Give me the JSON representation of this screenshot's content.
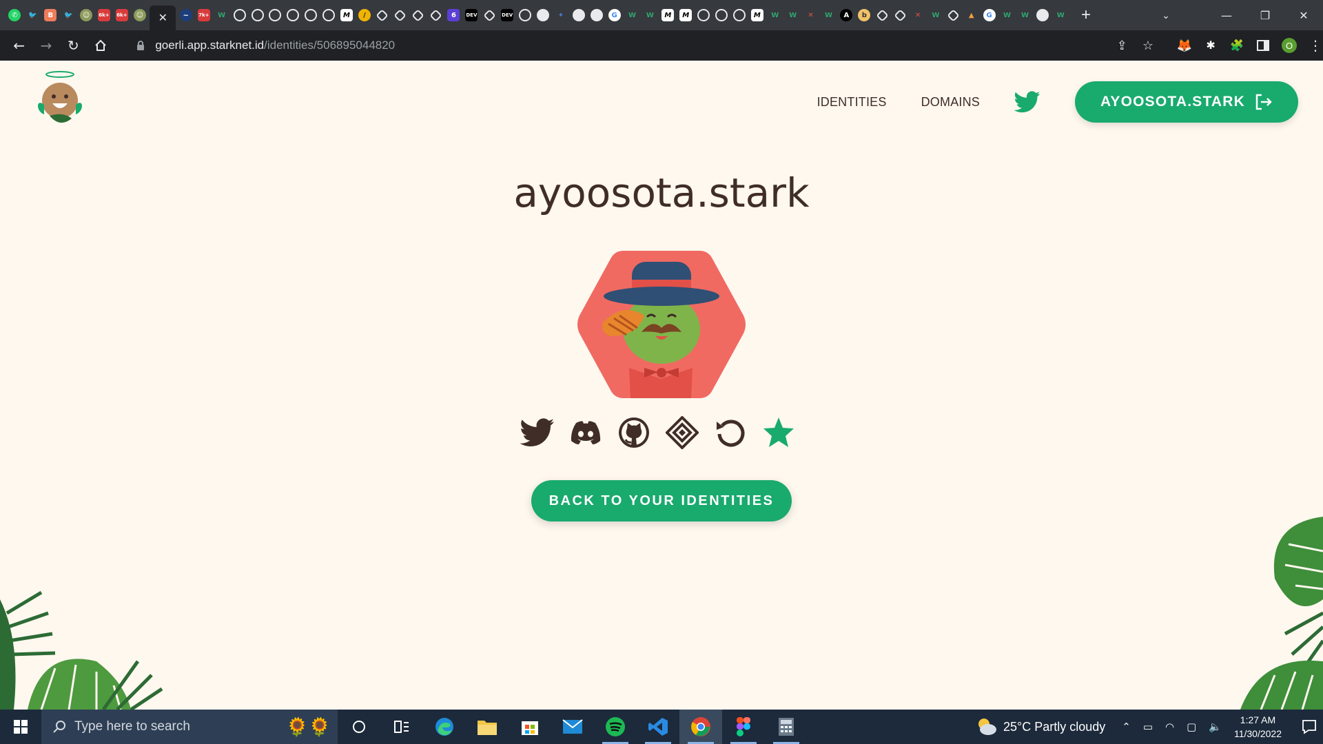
{
  "browser": {
    "url_host": "goerli.app.starknet.id",
    "url_path": "/identities/506895044820",
    "profile_initial": "O",
    "tab_close_glyph": "✕",
    "new_tab_glyph": "+",
    "tab_badges": [
      "6k+",
      "6k+",
      "7k+"
    ]
  },
  "header": {
    "nav_identities": "IDENTITIES",
    "nav_domains": "DOMAINS",
    "account_button_label": "AYOOSOTA.STARK"
  },
  "main": {
    "identity_title": "ayoosota.stark",
    "back_button_label": "BACK TO YOUR IDENTITIES",
    "social_icons": [
      "twitter-icon",
      "discord-icon",
      "github-icon",
      "diamond-icon",
      "refresh-icon",
      "star-icon"
    ]
  },
  "taskbar": {
    "search_placeholder": "Type here to search",
    "weather_text": "25°C  Partly cloudy",
    "time": "1:27 AM",
    "date": "11/30/2022"
  },
  "colors": {
    "accent_green": "#19aa6e",
    "text_brown": "#402d28",
    "page_bg": "#fef8ef"
  }
}
